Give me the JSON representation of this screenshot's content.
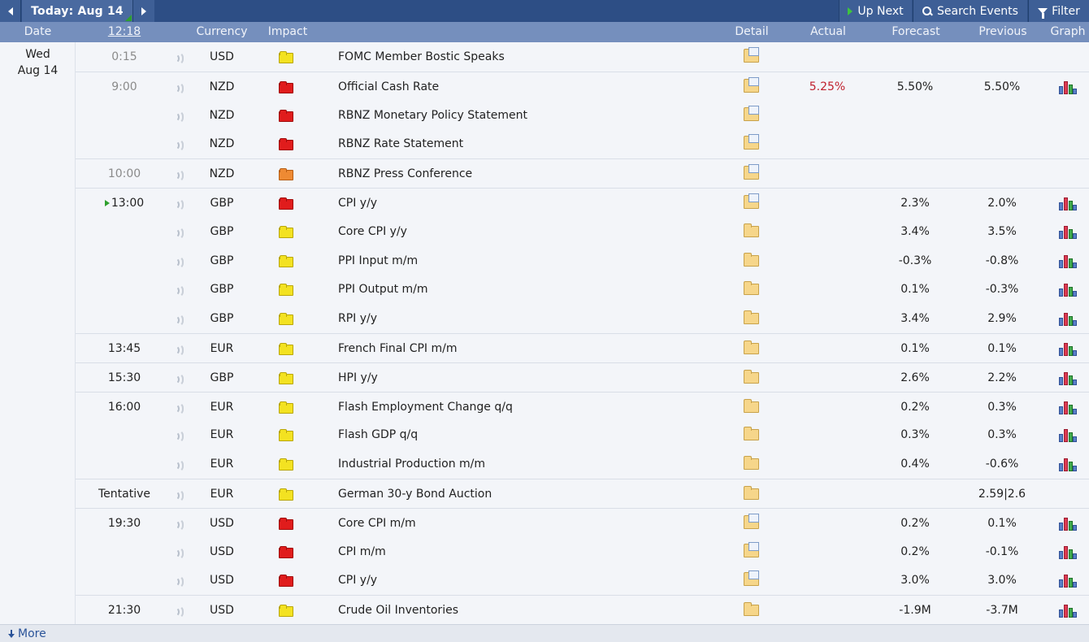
{
  "toolbar": {
    "today_label": "Today: Aug 14",
    "up_next_label": "Up Next",
    "search_label": "Search Events",
    "filter_label": "Filter"
  },
  "columns": {
    "date": "Date",
    "time": "12:18",
    "currency": "Currency",
    "impact": "Impact",
    "detail": "Detail",
    "actual": "Actual",
    "forecast": "Forecast",
    "previous": "Previous",
    "graph": "Graph"
  },
  "date_group": {
    "weekday": "Wed",
    "date": "Aug 14"
  },
  "rows": [
    {
      "time": "0:15",
      "currency": "USD",
      "impact": "low",
      "event": "FOMC Member Bostic Speaks",
      "detail": "open",
      "actual": "",
      "forecast": "",
      "previous": "",
      "graph": false,
      "past": true,
      "sep": false
    },
    {
      "time": "9:00",
      "currency": "NZD",
      "impact": "high",
      "event": "Official Cash Rate",
      "detail": "open",
      "actual": "5.25%",
      "forecast": "5.50%",
      "previous": "5.50%",
      "graph": true,
      "past": true,
      "sep": true
    },
    {
      "time": "",
      "currency": "NZD",
      "impact": "high",
      "event": "RBNZ Monetary Policy Statement",
      "detail": "open",
      "actual": "",
      "forecast": "",
      "previous": "",
      "graph": false,
      "past": true,
      "sep": false
    },
    {
      "time": "",
      "currency": "NZD",
      "impact": "high",
      "event": "RBNZ Rate Statement",
      "detail": "open",
      "actual": "",
      "forecast": "",
      "previous": "",
      "graph": false,
      "past": true,
      "sep": false
    },
    {
      "time": "10:00",
      "currency": "NZD",
      "impact": "med",
      "event": "RBNZ Press Conference",
      "detail": "open",
      "actual": "",
      "forecast": "",
      "previous": "",
      "graph": false,
      "past": true,
      "sep": true
    },
    {
      "time": "13:00",
      "currency": "GBP",
      "impact": "high",
      "event": "CPI y/y",
      "detail": "open",
      "actual": "",
      "forecast": "2.3%",
      "previous": "2.0%",
      "graph": true,
      "past": false,
      "next": true,
      "sep": true
    },
    {
      "time": "",
      "currency": "GBP",
      "impact": "low",
      "event": "Core CPI y/y",
      "detail": "closed",
      "actual": "",
      "forecast": "3.4%",
      "previous": "3.5%",
      "graph": true,
      "past": false,
      "sep": false
    },
    {
      "time": "",
      "currency": "GBP",
      "impact": "low",
      "event": "PPI Input m/m",
      "detail": "closed",
      "actual": "",
      "forecast": "-0.3%",
      "previous": "-0.8%",
      "graph": true,
      "past": false,
      "sep": false
    },
    {
      "time": "",
      "currency": "GBP",
      "impact": "low",
      "event": "PPI Output m/m",
      "detail": "closed",
      "actual": "",
      "forecast": "0.1%",
      "previous": "-0.3%",
      "graph": true,
      "past": false,
      "sep": false
    },
    {
      "time": "",
      "currency": "GBP",
      "impact": "low",
      "event": "RPI y/y",
      "detail": "closed",
      "actual": "",
      "forecast": "3.4%",
      "previous": "2.9%",
      "graph": true,
      "past": false,
      "sep": false
    },
    {
      "time": "13:45",
      "currency": "EUR",
      "impact": "low",
      "event": "French Final CPI m/m",
      "detail": "closed",
      "actual": "",
      "forecast": "0.1%",
      "previous": "0.1%",
      "graph": true,
      "past": false,
      "sep": true
    },
    {
      "time": "15:30",
      "currency": "GBP",
      "impact": "low",
      "event": "HPI y/y",
      "detail": "closed",
      "actual": "",
      "forecast": "2.6%",
      "previous": "2.2%",
      "graph": true,
      "past": false,
      "sep": true
    },
    {
      "time": "16:00",
      "currency": "EUR",
      "impact": "low",
      "event": "Flash Employment Change q/q",
      "detail": "closed",
      "actual": "",
      "forecast": "0.2%",
      "previous": "0.3%",
      "graph": true,
      "past": false,
      "sep": true
    },
    {
      "time": "",
      "currency": "EUR",
      "impact": "low",
      "event": "Flash GDP q/q",
      "detail": "closed",
      "actual": "",
      "forecast": "0.3%",
      "previous": "0.3%",
      "graph": true,
      "past": false,
      "sep": false
    },
    {
      "time": "",
      "currency": "EUR",
      "impact": "low",
      "event": "Industrial Production m/m",
      "detail": "closed",
      "actual": "",
      "forecast": "0.4%",
      "previous": "-0.6%",
      "graph": true,
      "past": false,
      "sep": false
    },
    {
      "time": "Tentative",
      "currency": "EUR",
      "impact": "low",
      "event": "German 30-y Bond Auction",
      "detail": "closed",
      "actual": "",
      "forecast": "",
      "previous": "2.59|2.6",
      "graph": false,
      "past": false,
      "sep": true
    },
    {
      "time": "19:30",
      "currency": "USD",
      "impact": "high",
      "event": "Core CPI m/m",
      "detail": "open",
      "actual": "",
      "forecast": "0.2%",
      "previous": "0.1%",
      "graph": true,
      "past": false,
      "sep": true
    },
    {
      "time": "",
      "currency": "USD",
      "impact": "high",
      "event": "CPI m/m",
      "detail": "open",
      "actual": "",
      "forecast": "0.2%",
      "previous": "-0.1%",
      "graph": true,
      "past": false,
      "sep": false
    },
    {
      "time": "",
      "currency": "USD",
      "impact": "high",
      "event": "CPI y/y",
      "detail": "open",
      "actual": "",
      "forecast": "3.0%",
      "previous": "3.0%",
      "graph": true,
      "past": false,
      "sep": false
    },
    {
      "time": "21:30",
      "currency": "USD",
      "impact": "low",
      "event": "Crude Oil Inventories",
      "detail": "closed",
      "actual": "",
      "forecast": "-1.9M",
      "previous": "-3.7M",
      "graph": true,
      "past": false,
      "sep": true
    }
  ],
  "footer": {
    "more_label": "More"
  }
}
